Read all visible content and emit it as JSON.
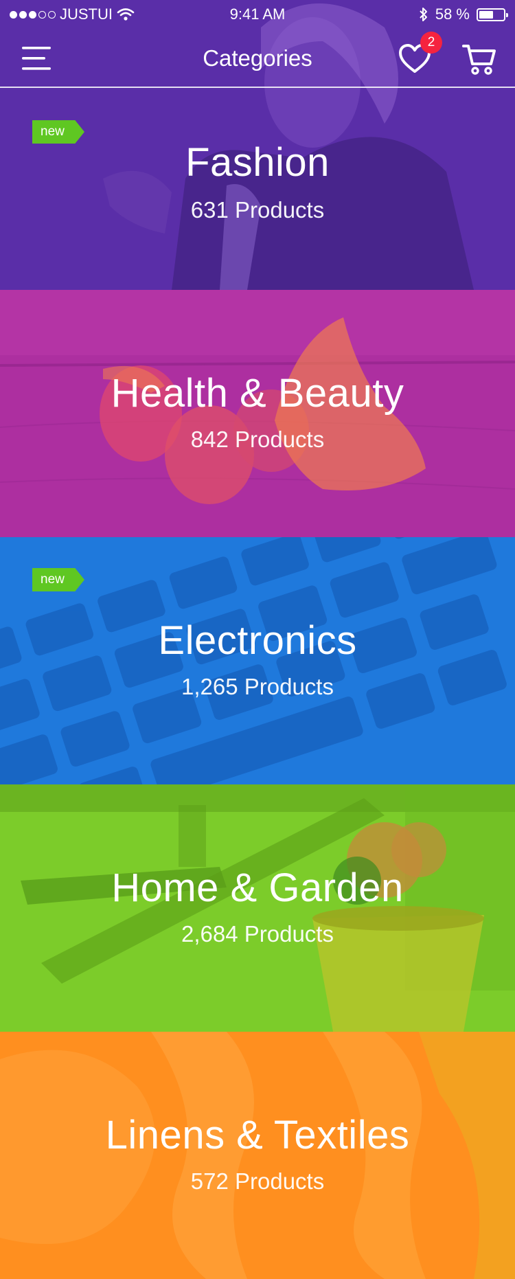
{
  "status_bar": {
    "carrier": "JUSTUI",
    "time": "9:41 AM",
    "battery": "58 %",
    "battery_level": 0.58
  },
  "nav": {
    "title": "Categories",
    "favorites_count": "2"
  },
  "badge_label": "new",
  "categories": [
    {
      "name": "Fashion",
      "count": "631 Products",
      "badge": true,
      "color": "#5a2ea8"
    },
    {
      "name": "Health & Beauty",
      "count": "842 Products",
      "badge": false,
      "color": "#ad2fa0"
    },
    {
      "name": "Electronics",
      "count": "1,265 Products",
      "badge": true,
      "color": "#1f79dc"
    },
    {
      "name": "Home & Garden",
      "count": "2,684 Products",
      "badge": false,
      "color": "#7ccc2a"
    },
    {
      "name": "Linens & Textiles",
      "count": "572 Products",
      "badge": false,
      "color": "#ff8f1f"
    }
  ]
}
